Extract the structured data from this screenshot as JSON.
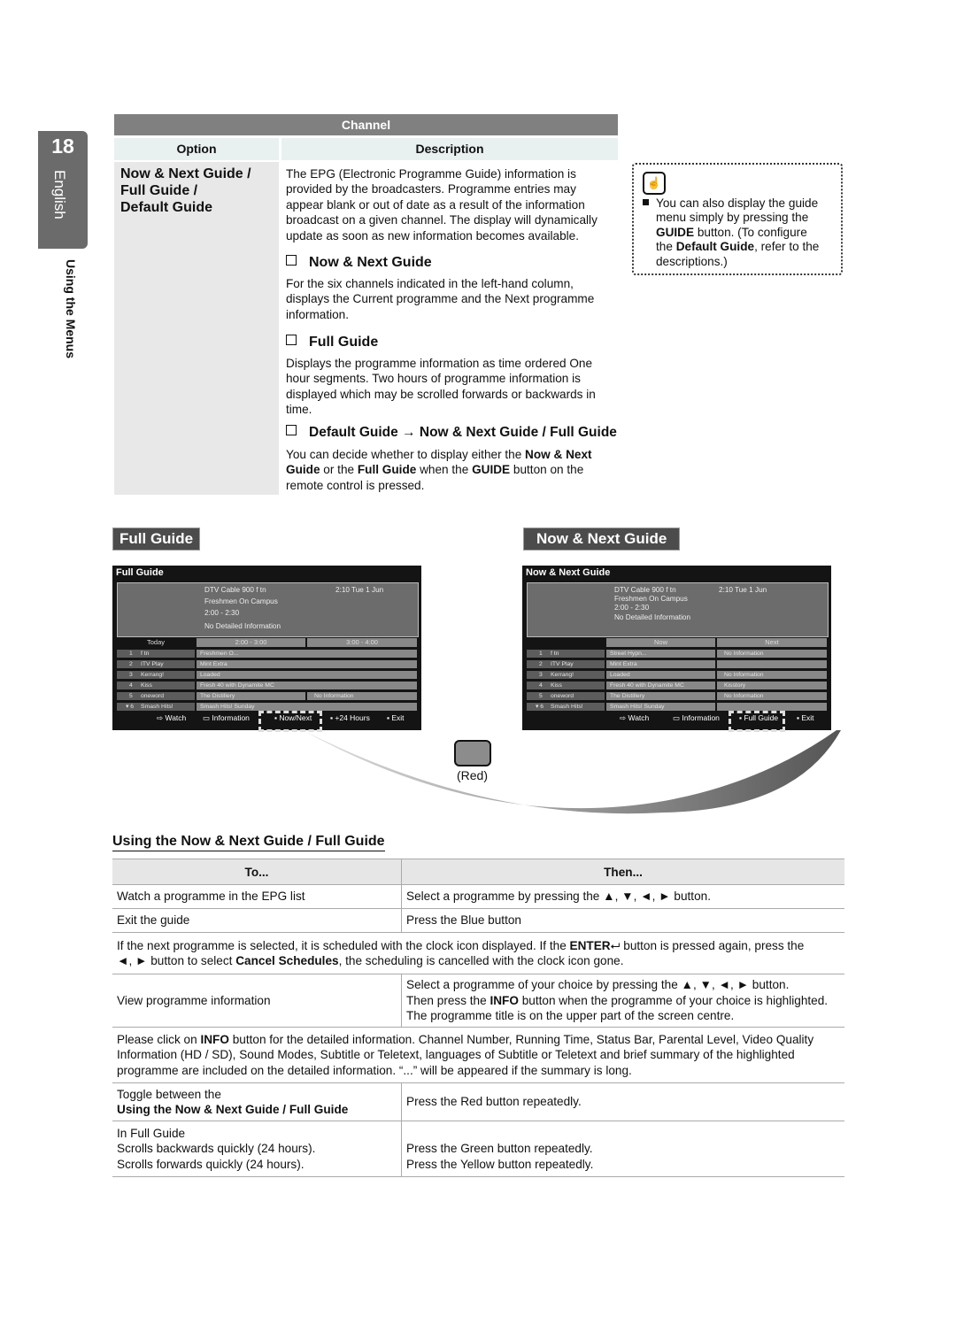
{
  "page": {
    "number": "18",
    "language": "English",
    "section": "Using the Menus"
  },
  "channel_table": {
    "title": "Channel",
    "headers": {
      "option": "Option",
      "description": "Description"
    },
    "option_lines": [
      "Now & Next Guide /",
      "Full Guide /",
      "Default Guide"
    ],
    "intro": [
      "The EPG (Electronic Programme Guide) information is",
      "provided by the broadcasters. Programme entries may",
      "appear blank or out of date as a result of the information",
      "broadcast on a given channel. The display will dynamically",
      "update as soon as new information becomes available."
    ],
    "sections": [
      {
        "title": "Now & Next Guide",
        "lines": [
          "For the six channels indicated in the left-hand column,",
          "displays the Current programme and the Next programme",
          "information."
        ]
      },
      {
        "title": "Full Guide",
        "lines": [
          "Displays the programme information as time ordered One",
          "hour segments. Two hours of programme information is",
          "displayed which may be scrolled forwards or backwards in",
          "time."
        ]
      },
      {
        "title": "Default Guide → Now & Next Guide / Full Guide",
        "lines_html": [
          "You can decide whether to display either the <b>Now & Next</b>",
          "<b>Guide</b> or the <b>Full Guide</b> when the <b>GUIDE</b> button on the",
          "remote control is pressed."
        ]
      }
    ]
  },
  "note": {
    "icon": "hand-pointer-icon",
    "lines_html": [
      "You can also display the guide",
      "menu simply by pressing the",
      "<b>GUIDE</b> button. (To configure",
      "the <b>Default Guide</b>, refer to the",
      "descriptions.)"
    ]
  },
  "labels": {
    "full_guide": "Full Guide",
    "now_next_guide": "Now & Next Guide"
  },
  "full_guide_screen": {
    "title": "Full Guide",
    "channel": "DTV Cable 900 f tn",
    "time": "2:10  Tue 1 Jun",
    "programme": "Freshmen On Campus",
    "slot": "2:00 - 2:30",
    "detail": "No Detailed Information",
    "headers": [
      "Today",
      "2:00 - 3:00",
      "3:00 - 4:00"
    ],
    "rows": [
      {
        "num": "1",
        "name": "f tn",
        "p1": "Freshmen O...",
        "p2": ""
      },
      {
        "num": "2",
        "name": "ITV Play",
        "p1": "Mint Extra",
        "p2": ""
      },
      {
        "num": "3",
        "name": "Kerrang!",
        "p1": "Loaded",
        "p2": ""
      },
      {
        "num": "4",
        "name": "Kiss",
        "p1": "Fresh 40 with Dynamite MC",
        "p2": ""
      },
      {
        "num": "5",
        "name": "oneword",
        "p1": "The Distillery",
        "p2": "No Information"
      },
      {
        "num": "6",
        "name": "Smash Hits!",
        "p1": "Smash Hits! Sunday",
        "p2": ""
      }
    ],
    "buttons": [
      "Watch",
      "Information",
      "Now/Next",
      "+24 Hours",
      "Exit"
    ]
  },
  "now_next_screen": {
    "title": "Now & Next Guide",
    "channel": "DTV Cable 900 f tn",
    "time": "2:10  Tue 1 Jun",
    "programme": "Freshmen On Campus",
    "slot": "2:00 - 2:30",
    "detail": "No Detailed Information",
    "headers": [
      "",
      "Now",
      "Next"
    ],
    "rows": [
      {
        "num": "1",
        "name": "f tn",
        "p1": "Street Hypn...",
        "p2": "No Information"
      },
      {
        "num": "2",
        "name": "ITV Play",
        "p1": "Mint Extra",
        "p2": ""
      },
      {
        "num": "3",
        "name": "Kerrang!",
        "p1": "Loaded",
        "p2": "No Information"
      },
      {
        "num": "4",
        "name": "Kiss",
        "p1": "Fresh 40 with Dynamite MC",
        "p2": "Kisstory"
      },
      {
        "num": "5",
        "name": "oneword",
        "p1": "The Distillery",
        "p2": "No Information"
      },
      {
        "num": "6",
        "name": "Smash Hits!",
        "p1": "Smash Hits! Sunday",
        "p2": ""
      }
    ],
    "buttons": [
      "Watch",
      "Information",
      "Full Guide",
      "Exit"
    ]
  },
  "red_button_label": "(Red)",
  "using": {
    "title": "Using the Now & Next Guide / Full Guide",
    "headers": [
      "To...",
      "Then..."
    ],
    "rows": [
      {
        "to": "Watch a programme in the EPG list",
        "then": "Select a programme by pressing the ▲, ▼, ◄, ► button."
      },
      {
        "to": "Exit the guide",
        "then": "Press the Blue button"
      },
      {
        "full_html": "If the next programme is selected, it is scheduled with the clock icon displayed. If the <b>ENTER</b>&#x2BA0; button is pressed again, press the<br>◄, ► button to select <b>Cancel Schedules</b>, the scheduling is cancelled with the clock icon gone."
      },
      {
        "to": "View programme information",
        "then_html": "Select a programme of your choice by pressing the ▲, ▼, ◄, ► button.<br>Then press the <b>INFO</b> button when the programme of your choice is highlighted.<br>The programme title is on the upper part of the screen centre."
      },
      {
        "full_html": "Please click on <b>INFO</b> button for the detailed information. Channel Number, Running Time, Status Bar, Parental Level, Video Quality<br>Information (HD / SD), Sound Modes, Subtitle or Teletext, languages of Subtitle or Teletext and brief summary of the highlighted<br>programme are included on the detailed information. “...” will be appeared if the summary is long."
      },
      {
        "to_html": "Toggle between the<br><b>Using the Now & Next Guide / Full Guide</b>",
        "then": "Press the Red button repeatedly."
      },
      {
        "to_html": "In Full Guide<br>Scrolls backwards quickly (24 hours).<br>Scrolls forwards quickly (24 hours).",
        "then_html": "<br>Press the Green button repeatedly.<br>Press the Yellow button repeatedly."
      }
    ]
  }
}
